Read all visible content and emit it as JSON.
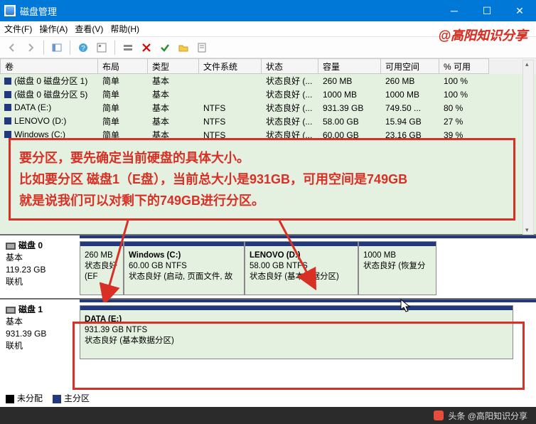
{
  "window": {
    "title": "磁盘管理",
    "watermark_top": "@高阳知识分享",
    "footer_wm": "头条 @高阳知识分享"
  },
  "menubar": {
    "file": "文件(F)",
    "action": "操作(A)",
    "view": "查看(V)",
    "help": "帮助(H)"
  },
  "columns": {
    "volume": "卷",
    "layout": "布局",
    "type": "类型",
    "fs": "文件系统",
    "status": "状态",
    "capacity": "容量",
    "free": "可用空间",
    "pct": "% 可用"
  },
  "rows": [
    {
      "vol": "(磁盘 0 磁盘分区 1)",
      "layout": "简单",
      "type": "基本",
      "fs": "",
      "status": "状态良好 (...",
      "cap": "260 MB",
      "free": "260 MB",
      "pct": "100 %"
    },
    {
      "vol": "(磁盘 0 磁盘分区 5)",
      "layout": "简单",
      "type": "基本",
      "fs": "",
      "status": "状态良好 (...",
      "cap": "1000 MB",
      "free": "1000 MB",
      "pct": "100 %"
    },
    {
      "vol": "DATA (E:)",
      "layout": "简单",
      "type": "基本",
      "fs": "NTFS",
      "status": "状态良好 (...",
      "cap": "931.39 GB",
      "free": "749.50 ...",
      "pct": "80 %"
    },
    {
      "vol": "LENOVO (D:)",
      "layout": "简单",
      "type": "基本",
      "fs": "NTFS",
      "status": "状态良好 (...",
      "cap": "58.00 GB",
      "free": "15.94 GB",
      "pct": "27 %"
    },
    {
      "vol": "Windows (C:)",
      "layout": "简单",
      "type": "基本",
      "fs": "NTFS",
      "status": "状态良好 (...",
      "cap": "60.00 GB",
      "free": "23.16 GB",
      "pct": "39 %"
    }
  ],
  "annotation": {
    "line1": "要分区，要先确定当前硬盘的具体大小。",
    "line2": "比如要分区 磁盘1（E盘），当前总大小是931GB，可用空间是749GB",
    "line3": "就是说我们可以对剩下的749GB进行分区。"
  },
  "disk0": {
    "name": "磁盘 0",
    "type": "基本",
    "size": "119.23 GB",
    "state": "联机",
    "parts": [
      {
        "title": "",
        "sub": "260 MB",
        "detail": "状态良好 (EF"
      },
      {
        "title": "Windows  (C:)",
        "sub": "60.00 GB NTFS",
        "detail": "状态良好 (启动, 页面文件, 故"
      },
      {
        "title": "LENOVO  (D:)",
        "sub": "58.00 GB NTFS",
        "detail": "状态良好 (基本数据分区)"
      },
      {
        "title": "",
        "sub": "1000 MB",
        "detail": "状态良好 (恢复分"
      }
    ]
  },
  "disk1": {
    "name": "磁盘 1",
    "type": "基本",
    "size": "931.39 GB",
    "state": "联机",
    "parts": [
      {
        "title": "DATA  (E:)",
        "sub": "931.39 GB NTFS",
        "detail": "状态良好 (基本数据分区)"
      }
    ]
  },
  "legend": {
    "unalloc": "未分配",
    "primary": "主分区"
  }
}
